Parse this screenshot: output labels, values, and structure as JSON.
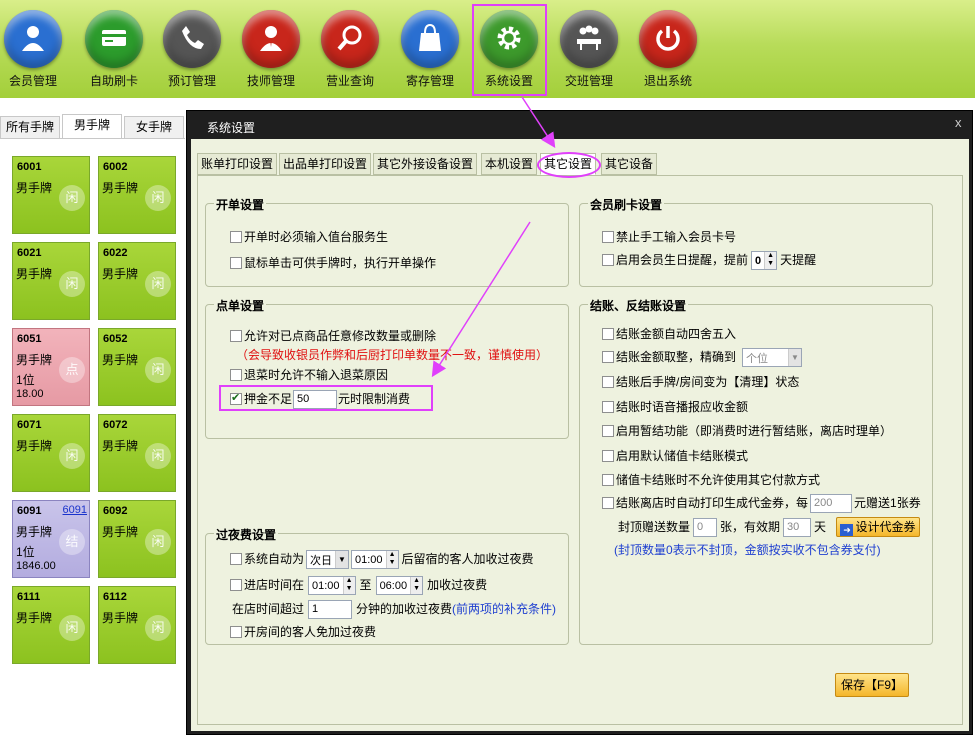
{
  "toolbar": {
    "buttons": [
      {
        "label": "会员管理",
        "icon": "member-icon",
        "color": "#2a6fd1"
      },
      {
        "label": "自助刷卡",
        "icon": "card-swipe-icon",
        "color": "#2c9c2c"
      },
      {
        "label": "预订管理",
        "icon": "phone-icon",
        "color": "#555555"
      },
      {
        "label": "技师管理",
        "icon": "technician-icon",
        "color": "#c8261b"
      },
      {
        "label": "营业查询",
        "icon": "search-icon",
        "color": "#c8261b"
      },
      {
        "label": "寄存管理",
        "icon": "bag-icon",
        "color": "#2a6fd1"
      },
      {
        "label": "系统设置",
        "icon": "gear-icon",
        "color": "#3d9a2c"
      },
      {
        "label": "交班管理",
        "icon": "shift-meeting-icon",
        "color": "#555555"
      },
      {
        "label": "退出系统",
        "icon": "power-icon",
        "color": "#c8261b"
      }
    ]
  },
  "left_tabs": [
    "所有手牌",
    "男手牌",
    "女手牌"
  ],
  "cards": [
    {
      "num": "6001",
      "kind": "男手牌",
      "link": "",
      "line3": "",
      "line4": "",
      "stamp": "闲",
      "status": "idle"
    },
    {
      "num": "6002",
      "kind": "男手牌",
      "link": "",
      "line3": "",
      "line4": "",
      "stamp": "闲",
      "status": "idle"
    },
    {
      "num": "6021",
      "kind": "男手牌",
      "link": "",
      "line3": "",
      "line4": "",
      "stamp": "闲",
      "status": "idle"
    },
    {
      "num": "6022",
      "kind": "男手牌",
      "link": "",
      "line3": "",
      "line4": "",
      "stamp": "闲",
      "status": "idle"
    },
    {
      "num": "6051",
      "kind": "男手牌",
      "link": "",
      "line3": "1位",
      "line4": "18.00",
      "stamp": "点",
      "status": "ordered"
    },
    {
      "num": "6052",
      "kind": "男手牌",
      "link": "",
      "line3": "",
      "line4": "",
      "stamp": "闲",
      "status": "idle"
    },
    {
      "num": "6071",
      "kind": "男手牌",
      "link": "",
      "line3": "",
      "line4": "",
      "stamp": "闲",
      "status": "idle"
    },
    {
      "num": "6072",
      "kind": "男手牌",
      "link": "",
      "line3": "",
      "line4": "",
      "stamp": "闲",
      "status": "idle"
    },
    {
      "num": "6091",
      "kind": "男手牌",
      "link": "6091",
      "line3": "1位",
      "line4": "1846.00",
      "stamp": "结",
      "status": "billing"
    },
    {
      "num": "6092",
      "kind": "男手牌",
      "link": "",
      "line3": "",
      "line4": "",
      "stamp": "闲",
      "status": "idle"
    },
    {
      "num": "6111",
      "kind": "男手牌",
      "link": "",
      "line3": "",
      "line4": "",
      "stamp": "闲",
      "status": "idle"
    },
    {
      "num": "6112",
      "kind": "男手牌",
      "link": "",
      "line3": "",
      "line4": "",
      "stamp": "闲",
      "status": "idle"
    }
  ],
  "dialog": {
    "title": "系统设置",
    "close": "x",
    "tabs": [
      "账单打印设置",
      "出品单打印设置",
      "其它外接设备设置",
      "本机设置",
      "其它设置",
      "其它设备"
    ],
    "active_tab": "其它设置",
    "open_order": {
      "title": "开单设置",
      "opt1": "开单时必须输入值台服务生",
      "opt2": "鼠标单击可供手牌时，执行开单操作"
    },
    "order": {
      "title": "点单设置",
      "opt1": "允许对已点商品任意修改数量或删除",
      "warning": "（会导致收银员作弊和后厨打印单数量不一致，谨慎使用）",
      "opt2": "退菜时允许不输入退菜原因",
      "deposit_prefix": "押金不足",
      "deposit_value": "50",
      "deposit_suffix": "元时限制消费"
    },
    "overnight": {
      "title": "过夜费设置",
      "auto_prefix": "系统自动为",
      "auto_day": "次日",
      "auto_time": "01:00",
      "auto_suffix": "后留宿的客人加收过夜费",
      "enter_prefix": "进店时间在",
      "enter_from": "01:00",
      "enter_to_word": "至",
      "enter_to": "06:00",
      "enter_suffix": "加收过夜费",
      "stay_prefix": "在店时间超过",
      "stay_value": "1",
      "stay_suffix": "分钟的加收过夜费",
      "stay_note": "(前两项的补充条件)",
      "free": "开房间的客人免加过夜费"
    },
    "member_card": {
      "title": "会员刷卡设置",
      "opt1": "禁止手工输入会员卡号",
      "birthday_prefix": "启用会员生日提醒，提前",
      "birthday_days": "0",
      "birthday_suffix": "天提醒"
    },
    "checkout": {
      "title": "结账、反结账设置",
      "opt1": "结账金额自动四舍五入",
      "round_prefix": "结账金额取整，精确到",
      "round_unit": "个位",
      "opt3": "结账后手牌/房间变为【清理】状态",
      "opt4": "结账时语音播报应收金额",
      "opt5": "启用暂结功能（即消费时进行暂结账，离店时理单）",
      "opt6": "启用默认储值卡结账模式",
      "opt7": "储值卡结账时不允许使用其它付款方式",
      "voucher_prefix": "结账离店时自动打印生成代金券，每",
      "voucher_amount": "200",
      "voucher_suffix": "元赠送1张券",
      "cap_prefix": "封顶赠送数量",
      "cap_value": "0",
      "cap_mid": "张，有效期",
      "valid_days": "30",
      "valid_unit": "天",
      "design_button": "设计代金券",
      "note": "(封顶数量0表示不封顶，金额按实收不包含券支付)"
    },
    "save_button": "保存【F9】"
  },
  "colors": {
    "highlight": "#e040fb",
    "card_green": "#9ccd2b",
    "card_pink": "#eaa6af",
    "card_purple": "#bdb7e4"
  }
}
